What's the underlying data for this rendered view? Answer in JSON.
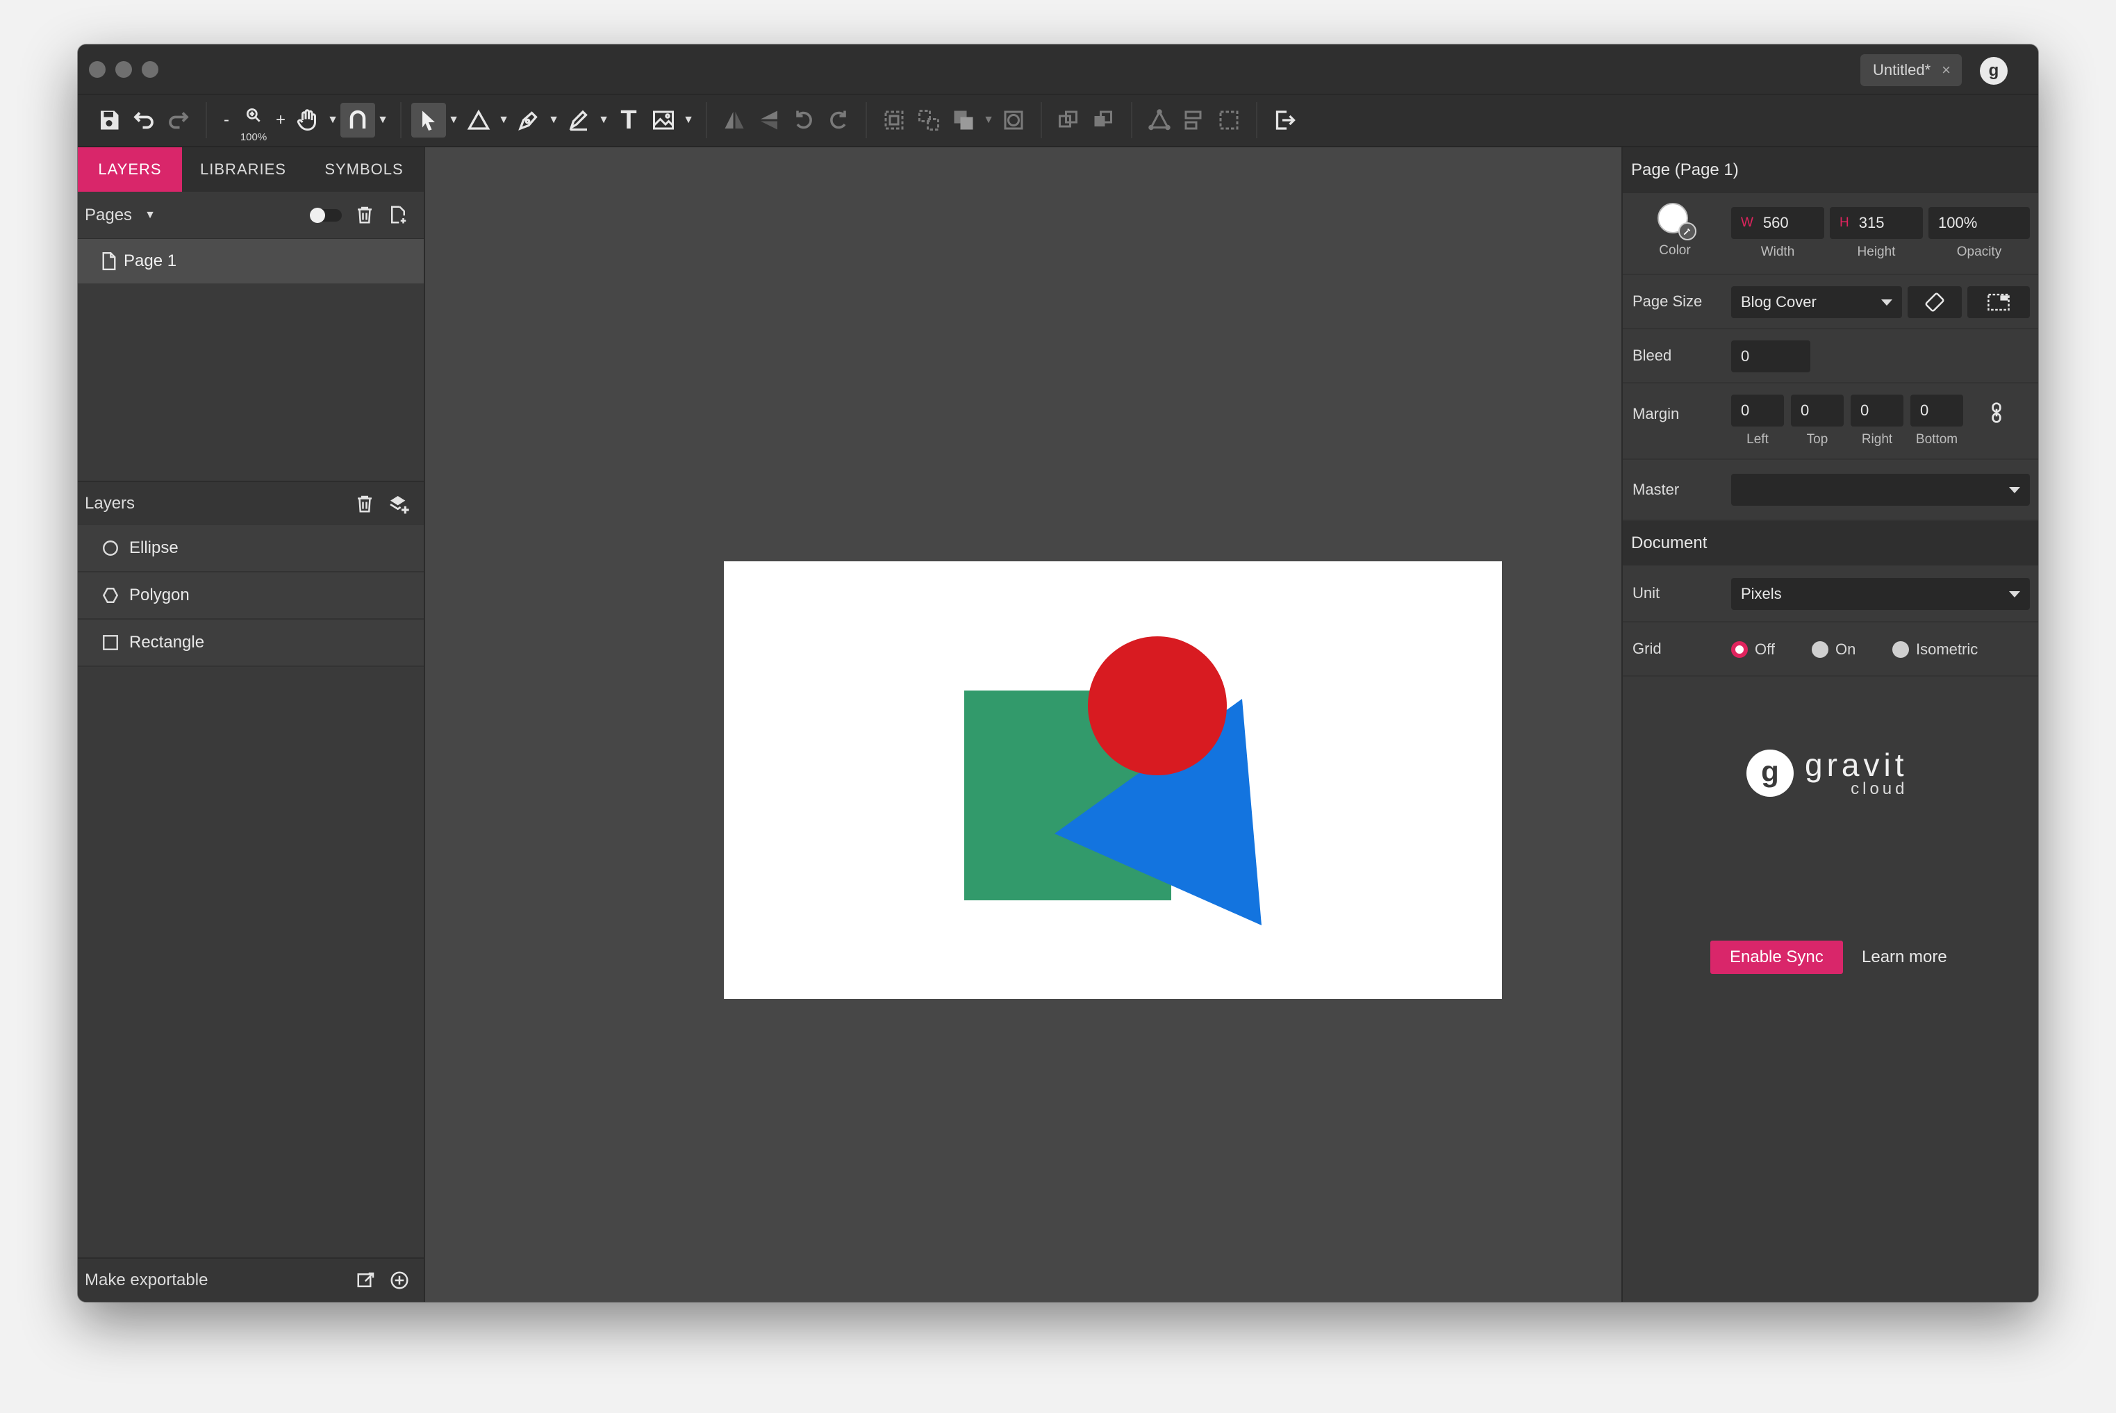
{
  "window": {
    "document_tab": "Untitled*",
    "document_tab_close": "×"
  },
  "toolbar": {
    "zoom_minus": "-",
    "zoom_plus": "+",
    "zoom_level": "100%",
    "text_tool_glyph": "T"
  },
  "left_panel": {
    "tabs": [
      "LAYERS",
      "LIBRARIES",
      "SYMBOLS"
    ],
    "active_tab": "LAYERS",
    "pages_label": "Pages",
    "pages": [
      {
        "name": "Page 1",
        "icon": "page-icon"
      }
    ],
    "layers_label": "Layers",
    "layers": [
      {
        "name": "Ellipse",
        "icon": "ellipse-icon"
      },
      {
        "name": "Polygon",
        "icon": "polygon-icon"
      },
      {
        "name": "Rectangle",
        "icon": "rectangle-icon"
      }
    ],
    "footer_label": "Make exportable"
  },
  "canvas": {
    "shapes": [
      {
        "type": "rectangle",
        "color": "#329a6b"
      },
      {
        "type": "polygon",
        "color": "#1374df"
      },
      {
        "type": "ellipse",
        "color": "#d81b21"
      }
    ]
  },
  "right_panel": {
    "header": "Page (Page 1)",
    "color_label": "Color",
    "width_prefix": "W",
    "width_value": "560",
    "width_label": "Width",
    "height_prefix": "H",
    "height_value": "315",
    "height_label": "Height",
    "opacity_value": "100%",
    "opacity_label": "Opacity",
    "page_size_label": "Page Size",
    "page_size_value": "Blog Cover",
    "bleed_label": "Bleed",
    "bleed_value": "0",
    "margin_label": "Margin",
    "margin": [
      {
        "value": "0",
        "label": "Left"
      },
      {
        "value": "0",
        "label": "Top"
      },
      {
        "value": "0",
        "label": "Right"
      },
      {
        "value": "0",
        "label": "Bottom"
      }
    ],
    "master_label": "Master",
    "master_value": "",
    "document_header": "Document",
    "unit_label": "Unit",
    "unit_value": "Pixels",
    "grid_label": "Grid",
    "grid_options": [
      "Off",
      "On",
      "Isometric"
    ],
    "grid_selected": "Off",
    "brand_name": "gravit",
    "brand_sub": "cloud",
    "enable_sync": "Enable Sync",
    "learn_more": "Learn more"
  },
  "colors": {
    "accent": "#d9266a",
    "radio_selected": "#e0245e"
  }
}
